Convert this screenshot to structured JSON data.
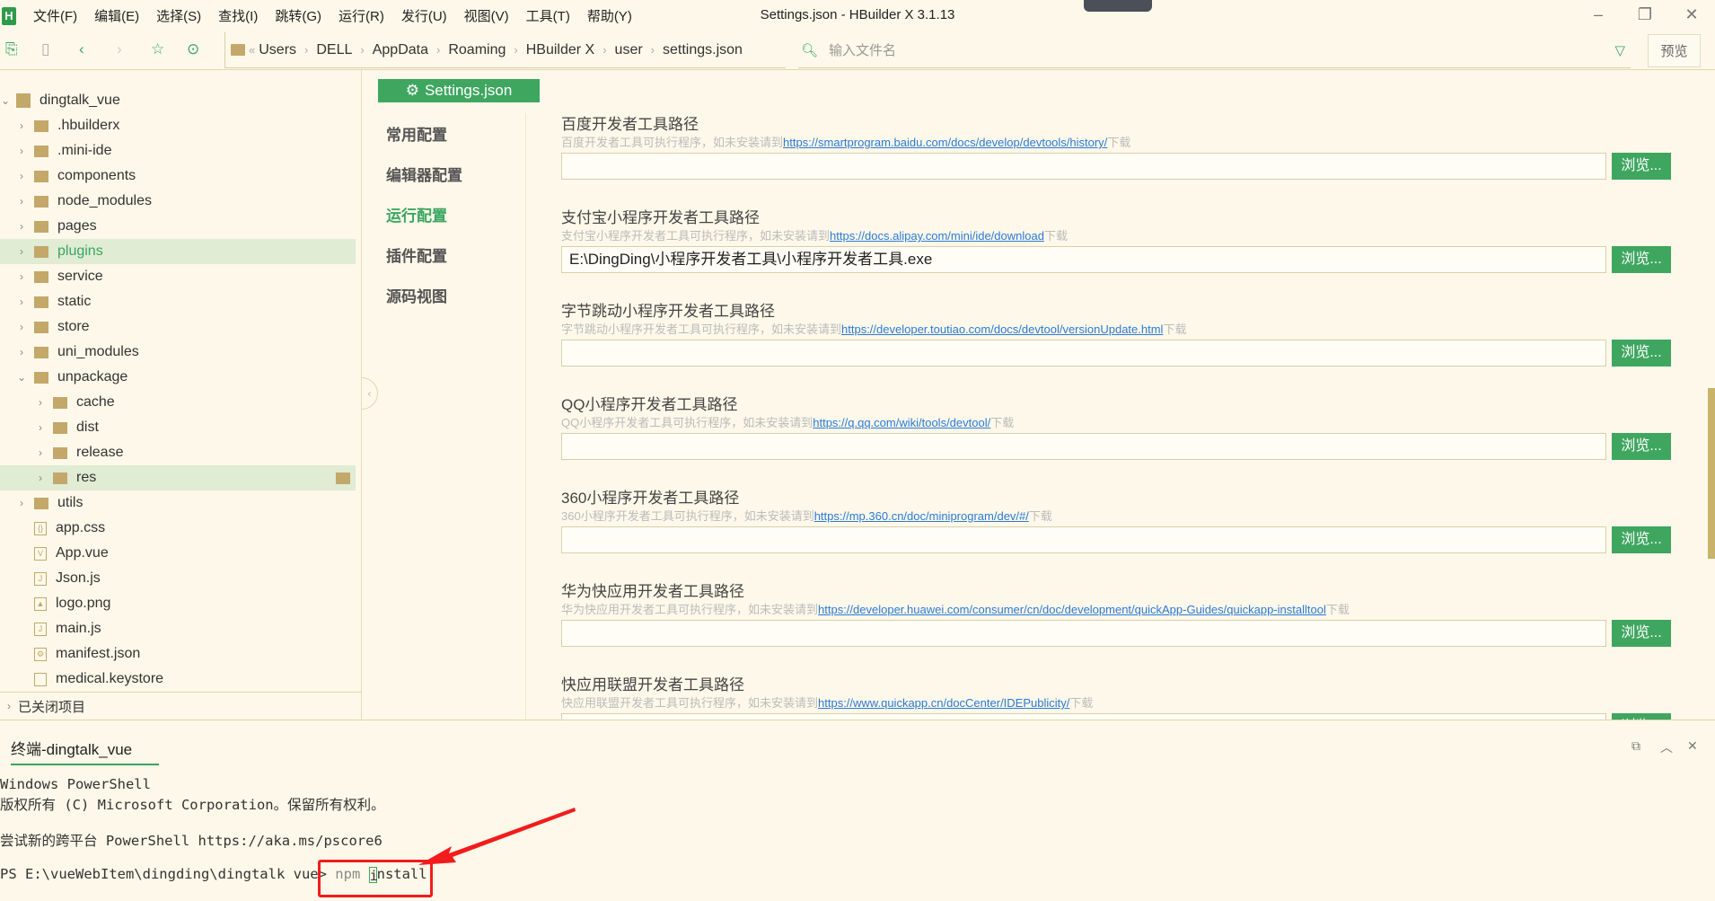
{
  "window": {
    "title": "Settings.json - HBuilder X 3.1.13",
    "logo": "H"
  },
  "menu": [
    "文件(F)",
    "编辑(E)",
    "选择(S)",
    "查找(I)",
    "跳转(G)",
    "运行(R)",
    "发行(U)",
    "视图(V)",
    "工具(T)",
    "帮助(Y)"
  ],
  "breadcrumb": [
    "Users",
    "DELL",
    "AppData",
    "Roaming",
    "HBuilder X",
    "user",
    "settings.json"
  ],
  "search": {
    "placeholder": "输入文件名"
  },
  "preview_label": "预览",
  "tree": {
    "root": "dingtalk_vue",
    "items": [
      {
        "label": ".hbuilderx",
        "type": "folder",
        "depth": 1
      },
      {
        "label": ".mini-ide",
        "type": "folder",
        "depth": 1
      },
      {
        "label": "components",
        "type": "folder",
        "depth": 1
      },
      {
        "label": "node_modules",
        "type": "folder",
        "depth": 1
      },
      {
        "label": "pages",
        "type": "folder",
        "depth": 1
      },
      {
        "label": "plugins",
        "type": "folder",
        "depth": 1,
        "selected": true
      },
      {
        "label": "service",
        "type": "folder",
        "depth": 1
      },
      {
        "label": "static",
        "type": "folder",
        "depth": 1
      },
      {
        "label": "store",
        "type": "folder",
        "depth": 1
      },
      {
        "label": "uni_modules",
        "type": "folder",
        "depth": 1
      },
      {
        "label": "unpackage",
        "type": "folder-open",
        "depth": 1
      },
      {
        "label": "cache",
        "type": "folder",
        "depth": 2
      },
      {
        "label": "dist",
        "type": "folder",
        "depth": 2
      },
      {
        "label": "release",
        "type": "folder",
        "depth": 2
      },
      {
        "label": "res",
        "type": "folder",
        "depth": 2,
        "hover": true
      },
      {
        "label": "utils",
        "type": "folder",
        "depth": 1
      },
      {
        "label": "app.css",
        "type": "css",
        "depth": 1
      },
      {
        "label": "App.vue",
        "type": "vue",
        "depth": 1
      },
      {
        "label": "Json.js",
        "type": "js",
        "depth": 1
      },
      {
        "label": "logo.png",
        "type": "image",
        "depth": 1
      },
      {
        "label": "main.js",
        "type": "js",
        "depth": 1
      },
      {
        "label": "manifest.json",
        "type": "json",
        "depth": 1
      },
      {
        "label": "medical.keystore",
        "type": "file",
        "depth": 1
      }
    ],
    "closed_projects": "已关闭项目"
  },
  "editor": {
    "tab": "Settings.json",
    "nav": [
      {
        "label": "常用配置"
      },
      {
        "label": "编辑器配置"
      },
      {
        "label": "运行配置",
        "active": true
      },
      {
        "label": "插件配置"
      },
      {
        "label": "源码视图"
      }
    ],
    "browse_label": "浏览...",
    "download_label": "下载",
    "sections": [
      {
        "title": "百度开发者工具路径",
        "desc": "百度开发者工具可执行程序，如未安装请到",
        "link": "https://smartprogram.baidu.com/docs/develop/devtools/history/",
        "value": ""
      },
      {
        "title": "支付宝小程序开发者工具路径",
        "desc": "支付宝小程序开发者工具可执行程序，如未安装请到",
        "link": "https://docs.alipay.com/mini/ide/download",
        "value": "E:\\DingDing\\小程序开发者工具\\小程序开发者工具.exe"
      },
      {
        "title": "字节跳动小程序开发者工具路径",
        "desc": "字节跳动小程序开发者工具可执行程序，如未安装请到",
        "link": "https://developer.toutiao.com/docs/devtool/versionUpdate.html",
        "value": ""
      },
      {
        "title": "QQ小程序开发者工具路径",
        "desc": "QQ小程序开发者工具可执行程序，如未安装请到",
        "link": "https://q.qq.com/wiki/tools/devtool/",
        "value": ""
      },
      {
        "title": "360小程序开发者工具路径",
        "desc": "360小程序开发者工具可执行程序，如未安装请到",
        "link": "https://mp.360.cn/doc/miniprogram/dev/#/",
        "value": ""
      },
      {
        "title": "华为快应用开发者工具路径",
        "desc": "华为快应用开发者工具可执行程序，如未安装请到",
        "link": "https://developer.huawei.com/consumer/cn/doc/development/quickApp-Guides/quickapp-installtool",
        "value": ""
      },
      {
        "title": "快应用联盟开发者工具路径",
        "desc": "快应用联盟开发者工具可执行程序，如未安装请到",
        "link": "https://www.quickapp.cn/docCenter/IDEPublicity/",
        "value": ""
      }
    ]
  },
  "terminal": {
    "tab": "终端-dingtalk_vue",
    "lines": [
      "Windows PowerShell",
      "版权所有 (C) Microsoft Corporation。保留所有权利。",
      "尝试新的跨平台 PowerShell https://aka.ms/pscore6"
    ],
    "prompt": "PS E:\\vueWebItem\\dingding\\dingtalk vue> ",
    "command_a": "npm ",
    "command_cursor": "i",
    "command_b": "nstall"
  },
  "colors": {
    "accent": "#3fa660",
    "background": "#fdf8e9",
    "link": "#2a7ad8",
    "annotation": "#f21c1c"
  }
}
